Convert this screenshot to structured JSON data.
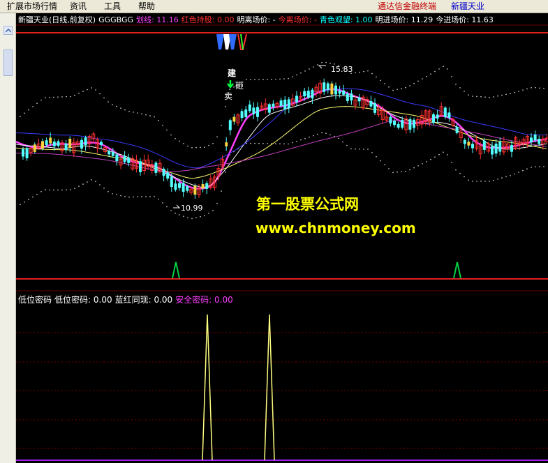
{
  "menu": {
    "items": [
      "扩展市场行情",
      "资讯",
      "工具",
      "帮助"
    ],
    "brand": "通达信金融终端",
    "stock_title": "新疆天业"
  },
  "main_legend": {
    "name": "新疆天业(日线,前复权)",
    "formula": "GGGBGG",
    "items": [
      {
        "label": "划线: 11.16",
        "color": "#ff40ff"
      },
      {
        "label": "红色持股: 0.00",
        "color": "#ff3030"
      },
      {
        "label": "明离场价: -",
        "color": "#ffffff"
      },
      {
        "label": "今离场价: -",
        "color": "#ff3030"
      },
      {
        "label": "青色观望: 1.00",
        "color": "#00ffff"
      },
      {
        "label": "明进场价: 11.29",
        "color": "#ffffff"
      },
      {
        "label": "今进场价: 11.63",
        "color": "#ffffff"
      }
    ]
  },
  "annotations": {
    "high_label": "15.83",
    "low_label": "10.99",
    "signal_top": "建",
    "signal_mid": "砸",
    "signal_sell": "卖"
  },
  "watermark": {
    "line1": "第一股票公式网",
    "line2": "www.chnmoney.com"
  },
  "sub_legend": {
    "name": "低位密码",
    "items": [
      {
        "label": "低位密码: 0.00",
        "color": "#ffffff"
      },
      {
        "label": "蓝红同现: 0.00",
        "color": "#ffffff"
      },
      {
        "label": "安全密码: 0.00",
        "color": "#ff40ff"
      }
    ]
  },
  "colors": {
    "up": "#ff3030",
    "down": "#54ffff",
    "ma_magenta": "#ff40ff",
    "ma_white": "#ffffff",
    "ma_yellow": "#ffff70",
    "ma_blue": "#3a3aff",
    "signal_green": "#00d040",
    "grid_red": "#b00000"
  }
}
